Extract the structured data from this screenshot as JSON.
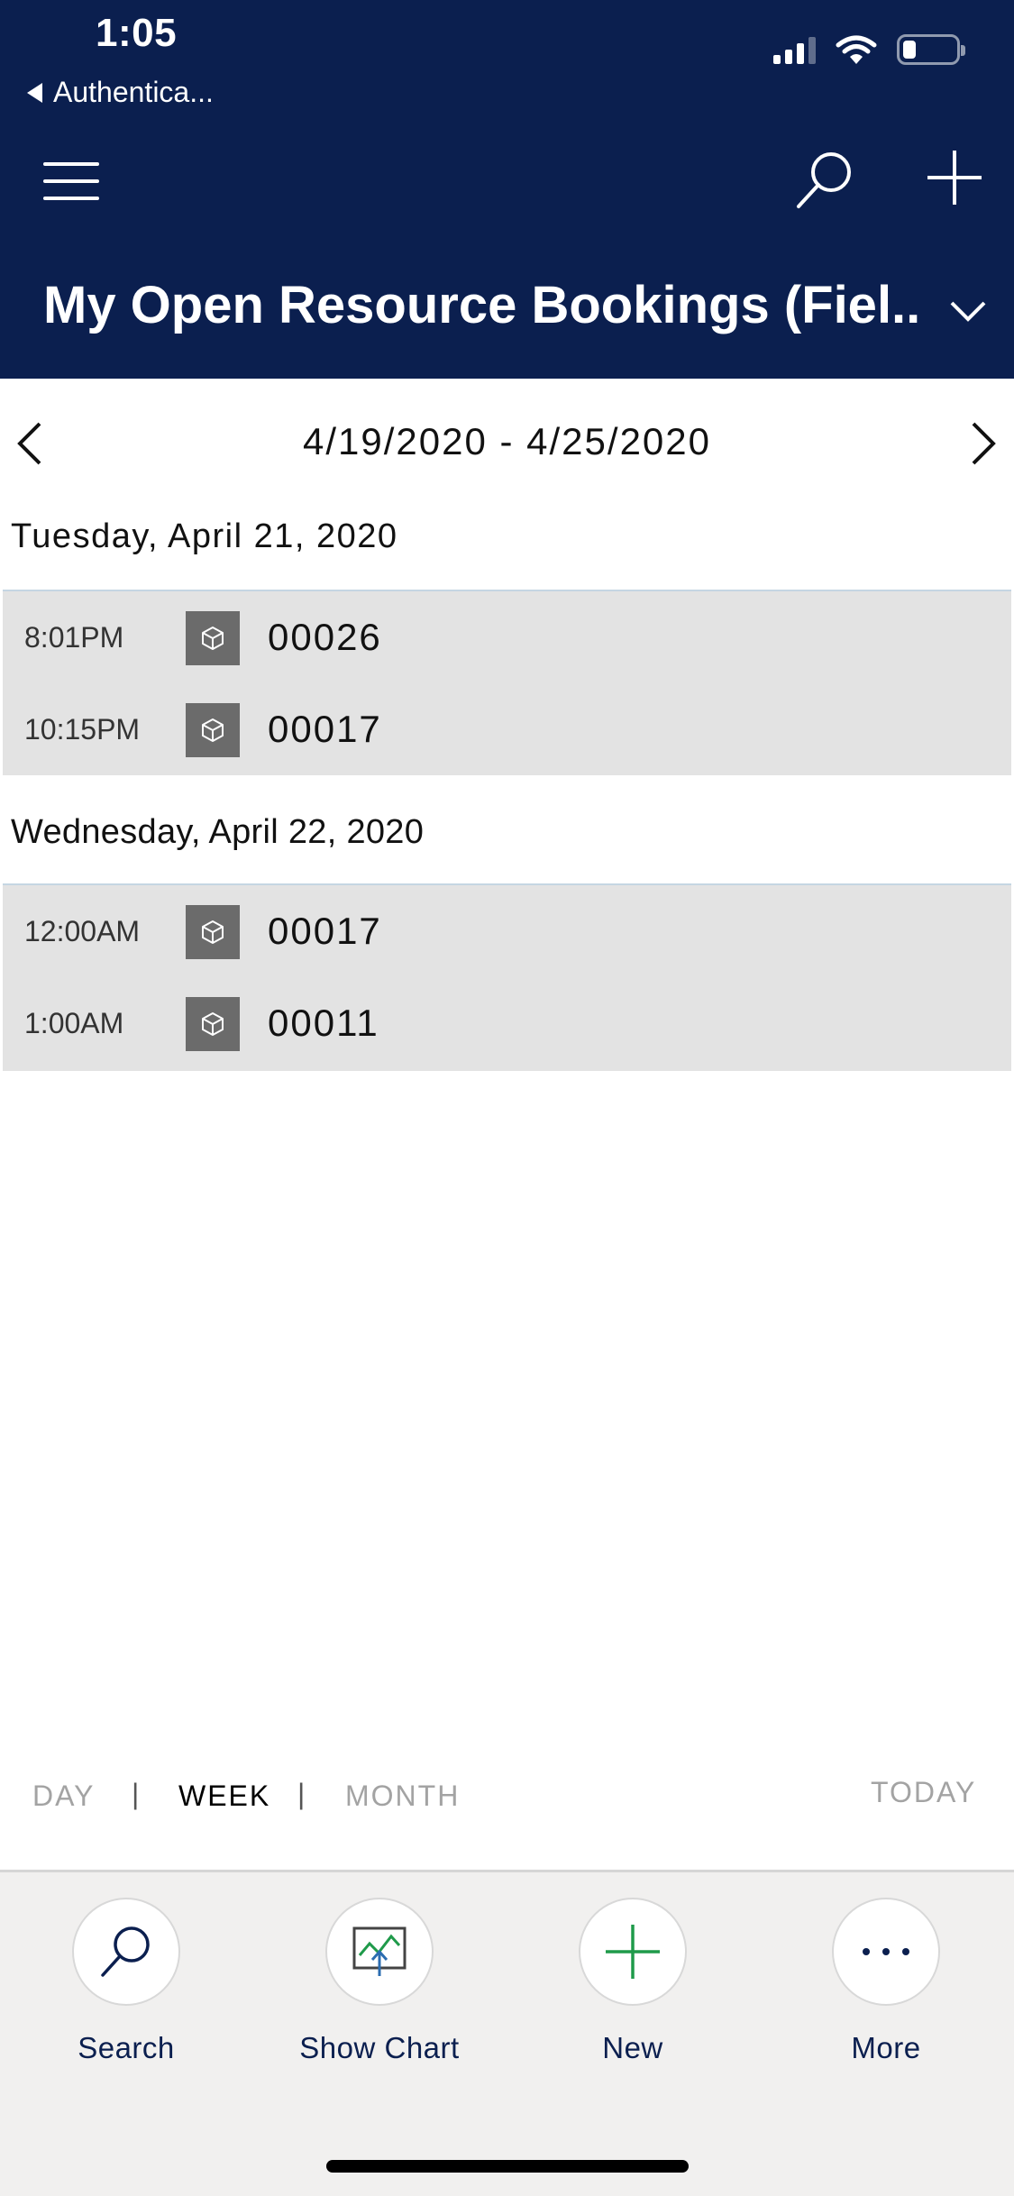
{
  "status_bar": {
    "time": "1:05",
    "back_label": "Authentica...",
    "battery_level": 0.25
  },
  "header": {
    "title": "My Open Resource Bookings (Fiel...",
    "background_color": "#0b1f4f",
    "icons": [
      "menu-icon",
      "search-icon",
      "add-icon",
      "chevron-down-icon"
    ]
  },
  "date_nav": {
    "range": "4/19/2020 - 4/25/2020"
  },
  "days": [
    {
      "heading": "Tuesday, April 21, 2020",
      "bookings": [
        {
          "time": "8:01PM",
          "name": "00026"
        },
        {
          "time": "10:15PM",
          "name": "00017"
        }
      ]
    },
    {
      "heading": "Wednesday, April 22, 2020",
      "bookings": [
        {
          "time": "12:00AM",
          "name": "00017"
        },
        {
          "time": "1:00AM",
          "name": "00011"
        }
      ]
    }
  ],
  "view_switch": {
    "day": "DAY",
    "week": "WEEK",
    "month": "MONTH",
    "today": "TODAY",
    "separator": "|",
    "active": "WEEK"
  },
  "commands": {
    "search": "Search",
    "show_chart": "Show Chart",
    "new": "New",
    "more": "More"
  },
  "colors": {
    "accent_green": "#1f9a4a",
    "accent_blue": "#2b6cb0",
    "row_background": "#e3e3e3"
  }
}
